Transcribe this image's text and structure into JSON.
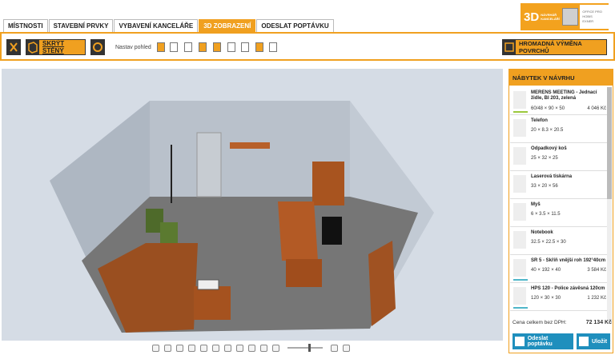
{
  "tabs": [
    "MÍSTNOSTI",
    "STAVEBNÍ PRVKY",
    "VYBAVENÍ KANCELÁŘE",
    "3D ZOBRAZENÍ",
    "ODESLAT POPTÁVKU"
  ],
  "active_tab": "3D ZOBRAZENÍ",
  "logo": {
    "main": "3D",
    "line1": "NÁVRHÁŘ",
    "line2": "KANCELÁŘÍ",
    "right1": "OFFICE PRO",
    "right2": "HOBIS",
    "right3": "EXNER"
  },
  "toolbar": {
    "hide_walls_label": "SKRÝT STĚNY",
    "view_label": "Nastav pohled",
    "bulk_label": "HROMADNÁ VÝMĚNA POVRCHŮ"
  },
  "panel": {
    "title": "NÁBYTEK V NÁVRHU",
    "items": [
      {
        "name": "MERENS MEETING - Jednací židle, BI 203, zelená",
        "dims": "60/48 × 90 × 50",
        "price": "4 046 Kč"
      },
      {
        "name": "Telefon",
        "dims": "20 × 8.3 × 20.5",
        "price": ""
      },
      {
        "name": "Odpadkový koš",
        "dims": "25 × 32 × 25",
        "price": ""
      },
      {
        "name": "Laserová tiskárna",
        "dims": "33 × 20 × 56",
        "price": ""
      },
      {
        "name": "Myš",
        "dims": "6 × 3.5 × 11.5",
        "price": ""
      },
      {
        "name": "Notebook",
        "dims": "32.5 × 22.5 × 30",
        "price": ""
      },
      {
        "name": "SR 5 - Skříň vnější roh 192°40cm",
        "dims": "40 × 192 × 40",
        "price": "3 584 Kč"
      },
      {
        "name": "HPS 120 - Police závěsná 120cm",
        "dims": "120 × 30 × 30",
        "price": "1 232 Kč"
      }
    ],
    "total_label": "Cena celkem bez DPH:",
    "total_value": "72 134 Kč",
    "send_label": "Odeslat poptávku",
    "save_label": "Uložit"
  },
  "colors": {
    "accent": "#f0a020",
    "button_blue": "#1f8fbd",
    "item_bar": "#4fb6c9"
  }
}
